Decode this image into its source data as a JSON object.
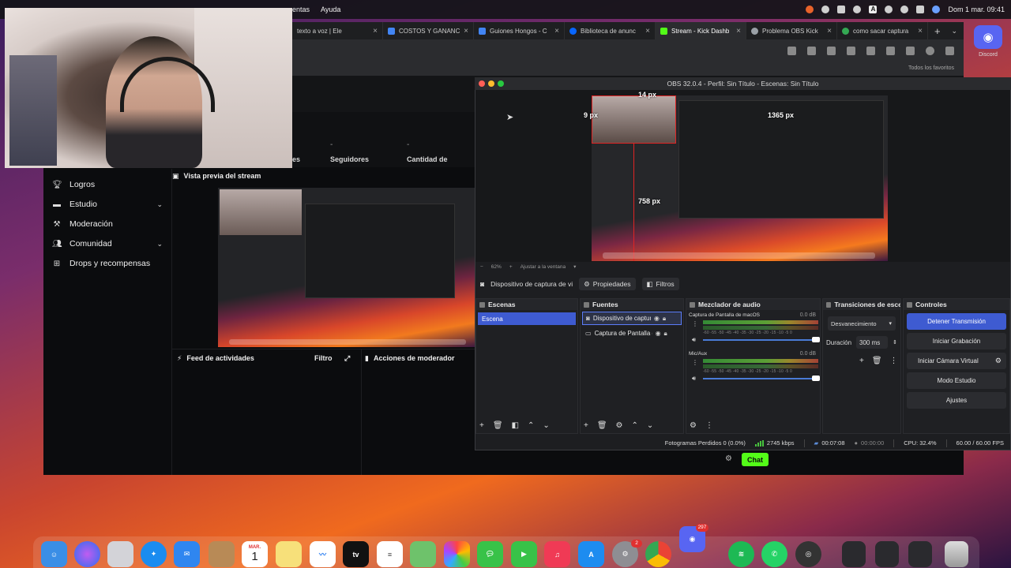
{
  "menubar": {
    "items": [
      "entas",
      "Ayuda"
    ],
    "clock": "Dom 1 mar.  09:41",
    "input_indicator": "A"
  },
  "browser": {
    "tabs": [
      {
        "label": "texto a voz | Ele",
        "color": "#3a3a3a"
      },
      {
        "label": "COSTOS Y GANANC",
        "color": "#4285f4"
      },
      {
        "label": "Guiones Hongos - C",
        "color": "#4285f4"
      },
      {
        "label": "Biblioteca de anunc",
        "color": "#0866ff"
      },
      {
        "label": "Stream - Kick Dashb",
        "color": "#53fc18"
      },
      {
        "label": "Problema OBS Kick",
        "color": "#9aa0a6"
      },
      {
        "label": "como sacar captura",
        "color": "#34a853"
      }
    ],
    "bookmarks_label": "Todos los favoritos"
  },
  "discord": {
    "label": "Discord"
  },
  "kick": {
    "stats": [
      "es",
      "Seguidores",
      "Cantidad de"
    ],
    "stat_values": [
      "-",
      "-"
    ],
    "sidebar": [
      {
        "label": "Logros",
        "icon": "trophy-icon",
        "expand": false
      },
      {
        "label": "Estudio",
        "icon": "studio-icon",
        "expand": true
      },
      {
        "label": "Moderación",
        "icon": "wrench-icon",
        "expand": false
      },
      {
        "label": "Comunidad",
        "icon": "people-icon",
        "expand": true
      },
      {
        "label": "Drops y recompensas",
        "icon": "gift-icon",
        "expand": false
      }
    ],
    "preview_title": "Vista previa del stream",
    "feed_title": "Feed de actividades",
    "feed_filter": "Filtro",
    "mod_title": "Acciones de moderador",
    "chat_button": "Chat"
  },
  "obs": {
    "title": "OBS 32.0.4 - Perfil: Sin Título - Escenas: Sin Título",
    "measurements": {
      "top": "14 px",
      "left": "9 px",
      "right": "1365 px",
      "bottom": "758 px"
    },
    "zoom": "62%",
    "zoom_fit": "Ajustar a la ventana",
    "source_toolbar": {
      "source": "Dispositivo de captura de vid",
      "properties": "Propiedades",
      "filters": "Filtros"
    },
    "scenes": {
      "title": "Escenas",
      "items": [
        "Escena"
      ]
    },
    "sources": {
      "title": "Fuentes",
      "items": [
        "Dispositivo de captura de video",
        "Captura de Pantalla de macOS"
      ]
    },
    "mixer": {
      "title": "Mezclador de audio",
      "channels": [
        {
          "name": "Captura de Pantalla de macOS",
          "db": "0.0 dB"
        },
        {
          "name": "Mic/Aux",
          "db": "0.0 dB"
        }
      ],
      "scale": "-60 -55 -50 -45 -40 -35 -30 -25 -20 -15 -10 -5 0"
    },
    "transitions": {
      "title": "Transiciones de esce...",
      "type": "Desvanecimiento",
      "duration_label": "Duración",
      "duration_value": "300 ms"
    },
    "controls": {
      "title": "Controles",
      "buttons": [
        "Detener Transmisión",
        "Iniciar Grabación",
        "Iniciar Cámara Virtual",
        "Modo Estudio",
        "Ajustes"
      ]
    },
    "status": {
      "dropped": "Fotogramas Perdidos 0 (0.0%)",
      "bitrate": "2745 kbps",
      "stream_time": "00:07:08",
      "rec_time": "00:00:00",
      "cpu": "CPU: 32.4%",
      "fps": "60.00 / 60.00 FPS"
    }
  },
  "dock": {
    "calendar_month": "MAR.",
    "calendar_day": "1",
    "appletv_label": "tv",
    "discord_badge": "297",
    "facetime_badge": "2"
  }
}
